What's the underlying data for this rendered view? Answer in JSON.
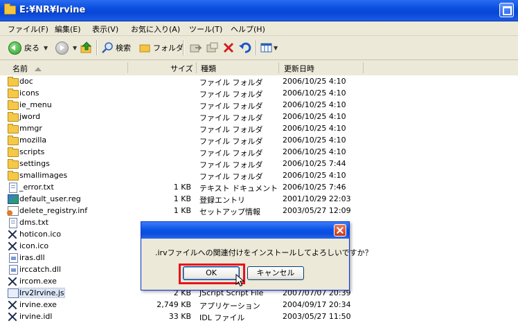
{
  "window": {
    "title": "E:¥NR¥Irvine"
  },
  "menu": [
    "ファイル(F)",
    "編集(E)",
    "表示(V)",
    "お気に入り(A)",
    "ツール(T)",
    "ヘルプ(H)"
  ],
  "toolbar": {
    "back": "戻る",
    "search": "検索",
    "folders": "フォルダ"
  },
  "columns": {
    "name": "名前",
    "size": "サイズ",
    "type": "種類",
    "date": "更新日時"
  },
  "files": [
    {
      "icon": "folder",
      "name": "doc",
      "size": "",
      "type": "ファイル フォルダ",
      "date": "2006/10/25 4:10"
    },
    {
      "icon": "folder",
      "name": "icons",
      "size": "",
      "type": "ファイル フォルダ",
      "date": "2006/10/25 4:10"
    },
    {
      "icon": "folder",
      "name": "ie_menu",
      "size": "",
      "type": "ファイル フォルダ",
      "date": "2006/10/25 4:10"
    },
    {
      "icon": "folder",
      "name": "jword",
      "size": "",
      "type": "ファイル フォルダ",
      "date": "2006/10/25 4:10"
    },
    {
      "icon": "folder",
      "name": "mmgr",
      "size": "",
      "type": "ファイル フォルダ",
      "date": "2006/10/25 4:10"
    },
    {
      "icon": "folder",
      "name": "mozilla",
      "size": "",
      "type": "ファイル フォルダ",
      "date": "2006/10/25 4:10"
    },
    {
      "icon": "folder",
      "name": "scripts",
      "size": "",
      "type": "ファイル フォルダ",
      "date": "2006/10/25 4:10"
    },
    {
      "icon": "folder",
      "name": "settings",
      "size": "",
      "type": "ファイル フォルダ",
      "date": "2006/10/25 7:44"
    },
    {
      "icon": "folder",
      "name": "smallimages",
      "size": "",
      "type": "ファイル フォルダ",
      "date": "2006/10/25 4:10"
    },
    {
      "icon": "file",
      "name": "_error.txt",
      "size": "1 KB",
      "type": "テキスト ドキュメント",
      "date": "2006/10/25 7:46"
    },
    {
      "icon": "reg",
      "name": "default_user.reg",
      "size": "1 KB",
      "type": "登録エントリ",
      "date": "2001/10/29 22:03"
    },
    {
      "icon": "inf",
      "name": "delete_registry.inf",
      "size": "1 KB",
      "type": "セットアップ情報",
      "date": "2003/05/27 12:09"
    },
    {
      "icon": "file",
      "name": "dms.txt",
      "size": "",
      "type": "",
      "date": ""
    },
    {
      "icon": "x",
      "name": "hoticon.ico",
      "size": "",
      "type": "",
      "date": ""
    },
    {
      "icon": "x",
      "name": "icon.ico",
      "size": "",
      "type": "",
      "date": ""
    },
    {
      "icon": "dll",
      "name": "iras.dll",
      "size": "",
      "type": "",
      "date": ""
    },
    {
      "icon": "dll",
      "name": "irccatch.dll",
      "size": "",
      "type": "",
      "date": ""
    },
    {
      "icon": "x",
      "name": "ircom.exe",
      "size": "",
      "type": "",
      "date": ""
    },
    {
      "icon": "js",
      "name": "Irv2Irvine.js",
      "size": "2 KB",
      "type": "JScript Script File",
      "date": "2007/07/07 20:39"
    },
    {
      "icon": "x",
      "name": "irvine.exe",
      "size": "2,749 KB",
      "type": "アプリケーション",
      "date": "2004/09/17 20:34"
    },
    {
      "icon": "x",
      "name": "irvine.idl",
      "size": "33 KB",
      "type": "IDL ファイル",
      "date": "2003/05/27 11:50"
    }
  ],
  "dialog": {
    "message": ".irvファイルへの関連付けをインストールしてよろしいですか？",
    "ok": "OK",
    "cancel": "キャンセル"
  }
}
